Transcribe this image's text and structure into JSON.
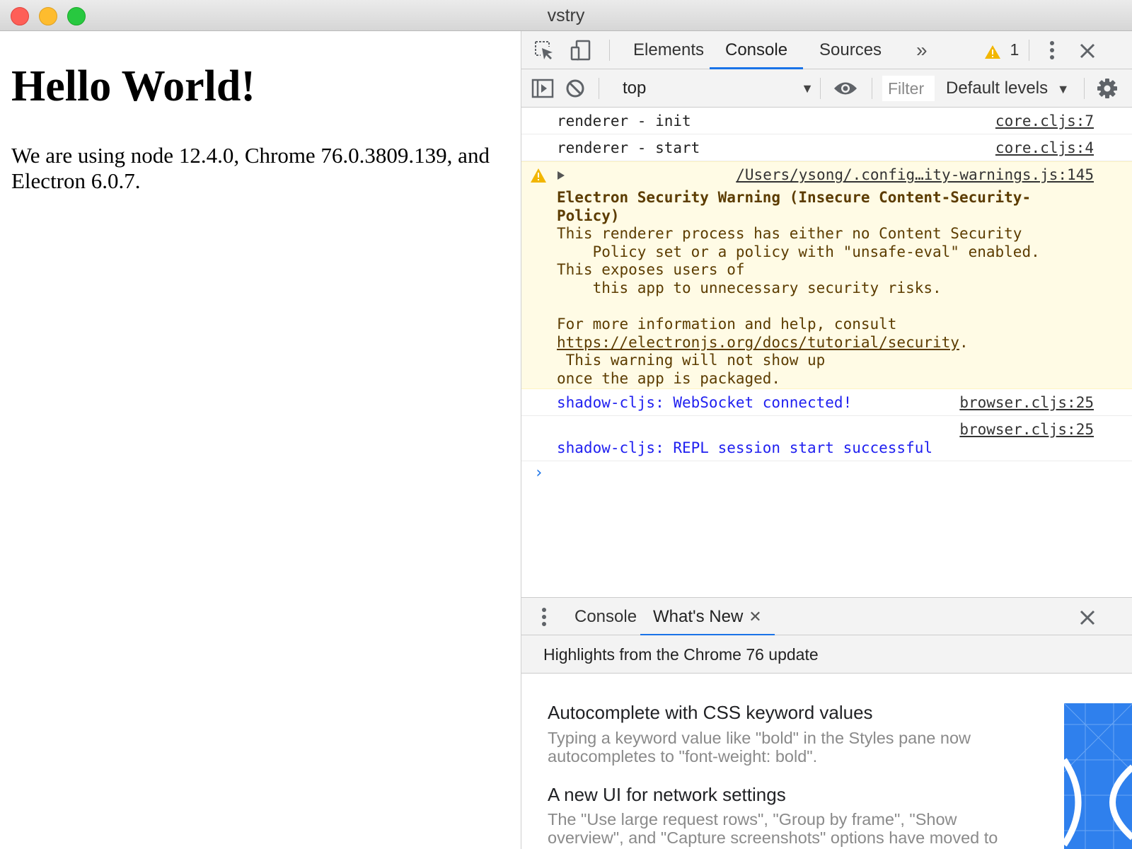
{
  "window": {
    "title": "vstry"
  },
  "page": {
    "heading": "Hello World!",
    "paragraph": "We are using node 12.4.0, Chrome 76.0.3809.139, and Electron 6.0.7."
  },
  "devtools": {
    "tabs": [
      "Elements",
      "Console",
      "Sources"
    ],
    "active_tab": "Console",
    "more_tabs": "»",
    "warning_count": "1",
    "console_toolbar": {
      "context": "top",
      "filter_placeholder": "Filter",
      "levels": "Default levels"
    },
    "messages": [
      {
        "text": "renderer - init",
        "source": "core.cljs:7",
        "level": "log"
      },
      {
        "text": "renderer - start",
        "source": "core.cljs:4",
        "level": "log"
      },
      {
        "level": "warning",
        "source": "/Users/ysong/.config…ity-warnings.js:145",
        "title_line1": "Electron Security Warning (Insecure Content-Security-",
        "title_line2": "Policy)",
        "body_line1": "This renderer process has either no Content Security",
        "body_line2": "    Policy set or a policy with \"unsafe-eval\" enabled.",
        "body_line3": "This exposes users of",
        "body_line4": "    this app to unnecessary security risks.",
        "body_line5": "For more information and help, consult",
        "link": "https://electronjs.org/docs/tutorial/security",
        "link_suffix": ".",
        "body_line6": " This warning will not show up",
        "body_line7": "once the app is packaged."
      },
      {
        "text": "shadow-cljs: WebSocket connected!",
        "source": "browser.cljs:25",
        "level": "info"
      },
      {
        "text": "shadow-cljs: REPL session start successful",
        "source": "browser.cljs:25",
        "level": "info"
      }
    ],
    "prompt": "›",
    "drawer": {
      "tabs": [
        "Console",
        "What's New"
      ],
      "active_tab": "What's New",
      "header": "Highlights from the Chrome 76 update",
      "items": [
        {
          "title": "Autocomplete with CSS keyword values",
          "description": "Typing a keyword value like \"bold\" in the Styles pane now autocompletes to \"font-weight: bold\"."
        },
        {
          "title": "A new UI for network settings",
          "description": "The \"Use large request rows\", \"Group by frame\", \"Show overview\", and \"Capture screenshots\" options have moved to the new Network Settings pane."
        }
      ]
    }
  },
  "colors": {
    "accent": "#1a73e8",
    "warning_bg": "#fffbe5",
    "warning_text": "#5c3c00",
    "info_text": "#1f1ff0",
    "warning_icon": "#f2b600"
  }
}
